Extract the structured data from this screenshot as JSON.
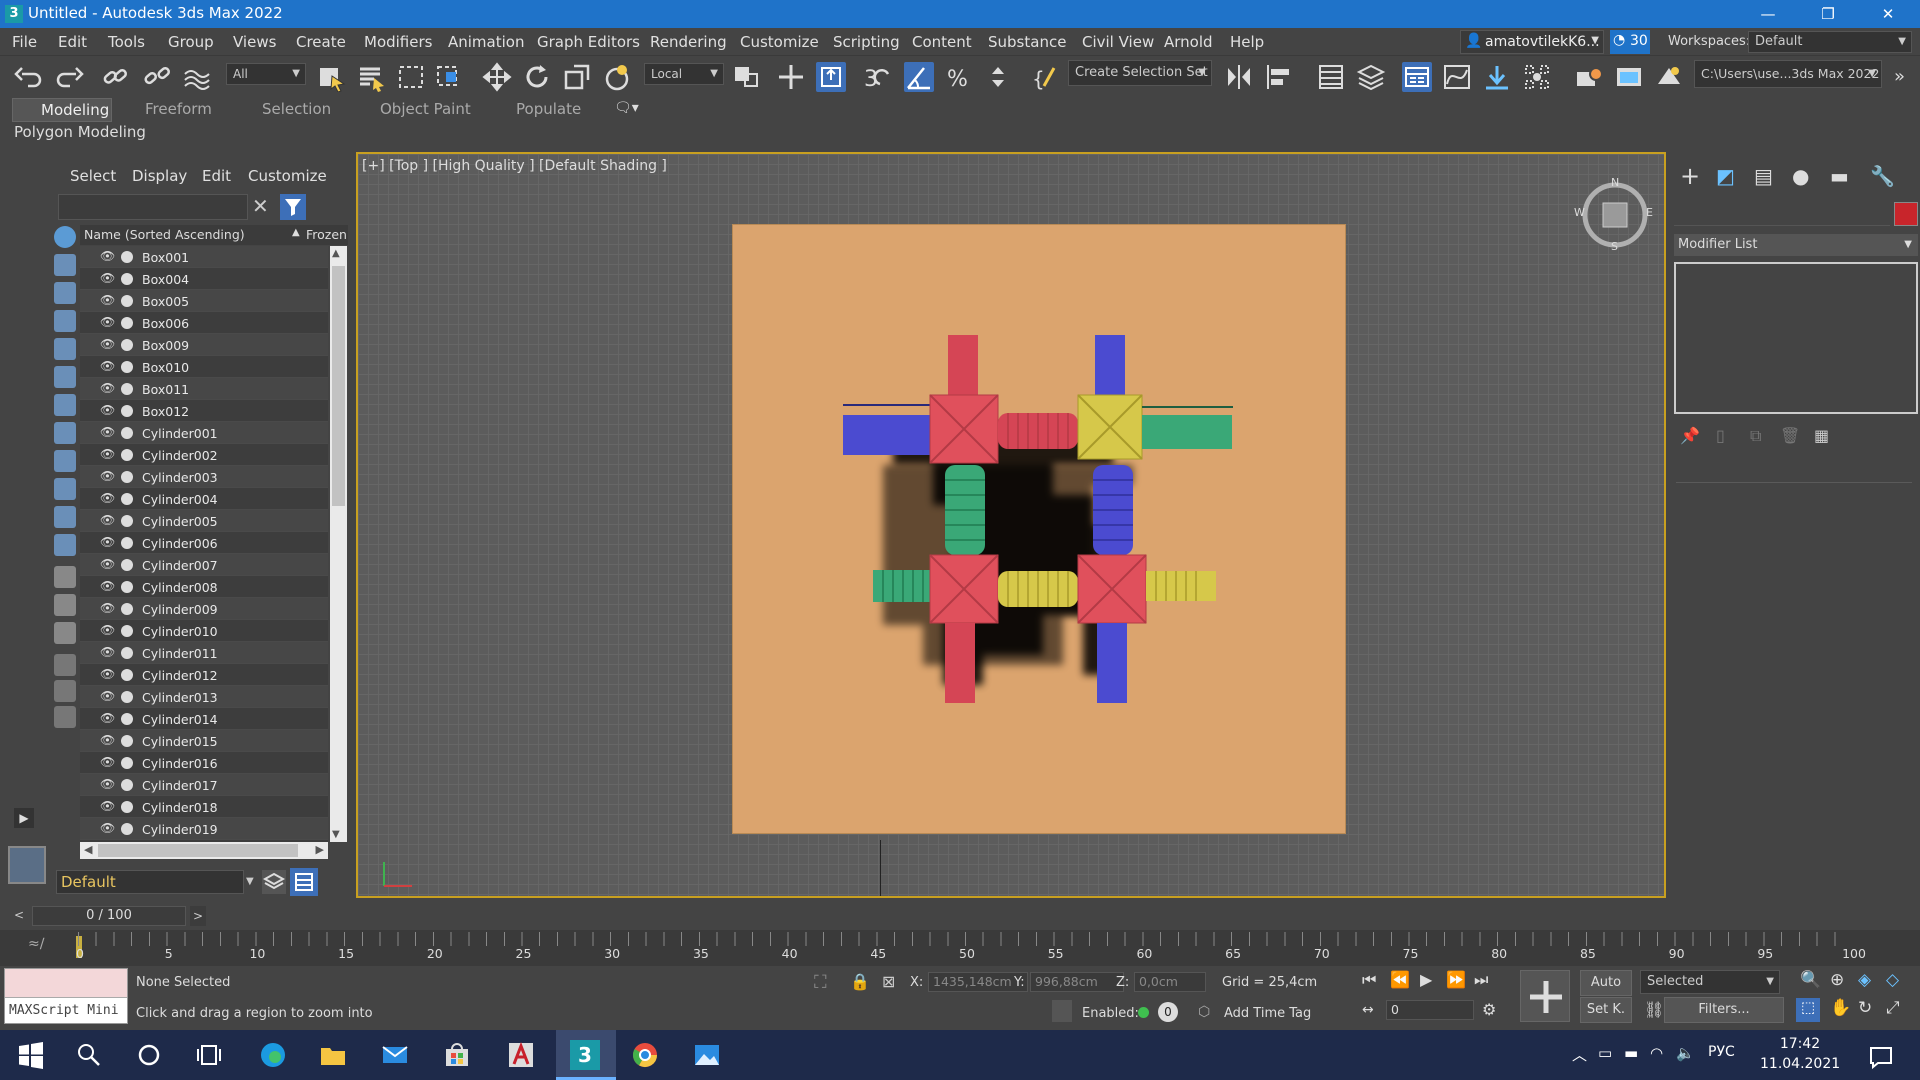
{
  "title_bar": {
    "title": "Untitled - Autodesk 3ds Max 2022",
    "app_icon": "3",
    "min": "—",
    "max": "❐",
    "close": "✕"
  },
  "menu": [
    "File",
    "Edit",
    "Tools",
    "Group",
    "Views",
    "Create",
    "Modifiers",
    "Animation",
    "Graph Editors",
    "Rendering",
    "Customize",
    "Scripting",
    "Content",
    "Substance",
    "Civil View",
    "Arnold",
    "Help"
  ],
  "user": {
    "name": "amatovtilekK6...",
    "count": "30",
    "workspaces_label": "Workspaces:",
    "workspace": "Default"
  },
  "toolbar": {
    "filter": "All",
    "ref_coord": "Local",
    "selection_set": "Create Selection Set",
    "project_path": "C:\\Users\\use...3ds Max 2022"
  },
  "ribbon": {
    "tabs": [
      "Modeling",
      "Freeform",
      "Selection",
      "Object Paint",
      "Populate"
    ],
    "panel": "Polygon Modeling"
  },
  "explorer": {
    "menu": [
      "Select",
      "Display",
      "Edit",
      "Customize"
    ],
    "header_name": "Name (Sorted Ascending)",
    "header_frozen": "Frozen",
    "items": [
      "Box001",
      "Box004",
      "Box005",
      "Box006",
      "Box009",
      "Box010",
      "Box011",
      "Box012",
      "Cylinder001",
      "Cylinder002",
      "Cylinder003",
      "Cylinder004",
      "Cylinder005",
      "Cylinder006",
      "Cylinder007",
      "Cylinder008",
      "Cylinder009",
      "Cylinder010",
      "Cylinder011",
      "Cylinder012",
      "Cylinder013",
      "Cylinder014",
      "Cylinder015",
      "Cylinder016",
      "Cylinder017",
      "Cylinder018",
      "Cylinder019"
    ],
    "layer": "Default"
  },
  "viewport": {
    "label": "[+] [Top ] [High Quality ] [Default Shading ]",
    "compass": {
      "n": "N",
      "s": "S",
      "w": "W",
      "e": "E"
    }
  },
  "command_panel": {
    "modifier_list": "Modifier List",
    "object_color": "#c8252b"
  },
  "timeline": {
    "frame": "0 / 100",
    "ticks": [
      "0",
      "5",
      "10",
      "15",
      "20",
      "25",
      "30",
      "35",
      "40",
      "45",
      "50",
      "55",
      "60",
      "65",
      "70",
      "75",
      "80",
      "85",
      "90",
      "95",
      "100"
    ]
  },
  "status": {
    "maxscript": "MAXScript Mini",
    "selection": "None Selected",
    "prompt": "Click and drag a region to zoom into",
    "x_label": "X:",
    "x": "1435,148cm",
    "y_label": "Y:",
    "y": "996,88cm",
    "z_label": "Z:",
    "z": "0,0cm",
    "grid": "Grid = 25,4cm",
    "enabled": "Enabled:",
    "enabled_value": "0",
    "time_tag": "Add Time Tag",
    "auto": "Auto",
    "selected": "Selected",
    "setk": "Set K.",
    "filters": "Filters...",
    "frame_field": "0"
  },
  "taskbar": {
    "lang": "РУС",
    "time": "17:42",
    "date": "11.04.2021"
  }
}
